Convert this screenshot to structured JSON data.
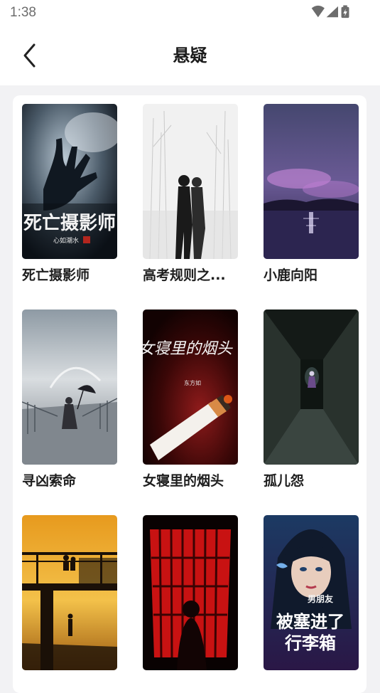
{
  "status": {
    "time": "1:38"
  },
  "header": {
    "title": "悬疑"
  },
  "books": [
    {
      "title": "死亡摄影师",
      "cover_text": "死亡摄影师",
      "cover_author": "心如潮水"
    },
    {
      "title": "高考规则之..."
    },
    {
      "title": "小鹿向阳"
    },
    {
      "title": "寻凶索命"
    },
    {
      "title": "女寝里的烟头",
      "cover_text": "女寝里的烟头",
      "cover_author": "东方如"
    },
    {
      "title": "孤儿怨"
    },
    {
      "title": ""
    },
    {
      "title": ""
    },
    {
      "title": "",
      "cover_text_a": "男朋友",
      "cover_text_b": "被塞进了",
      "cover_text_c": "行李箱"
    }
  ]
}
